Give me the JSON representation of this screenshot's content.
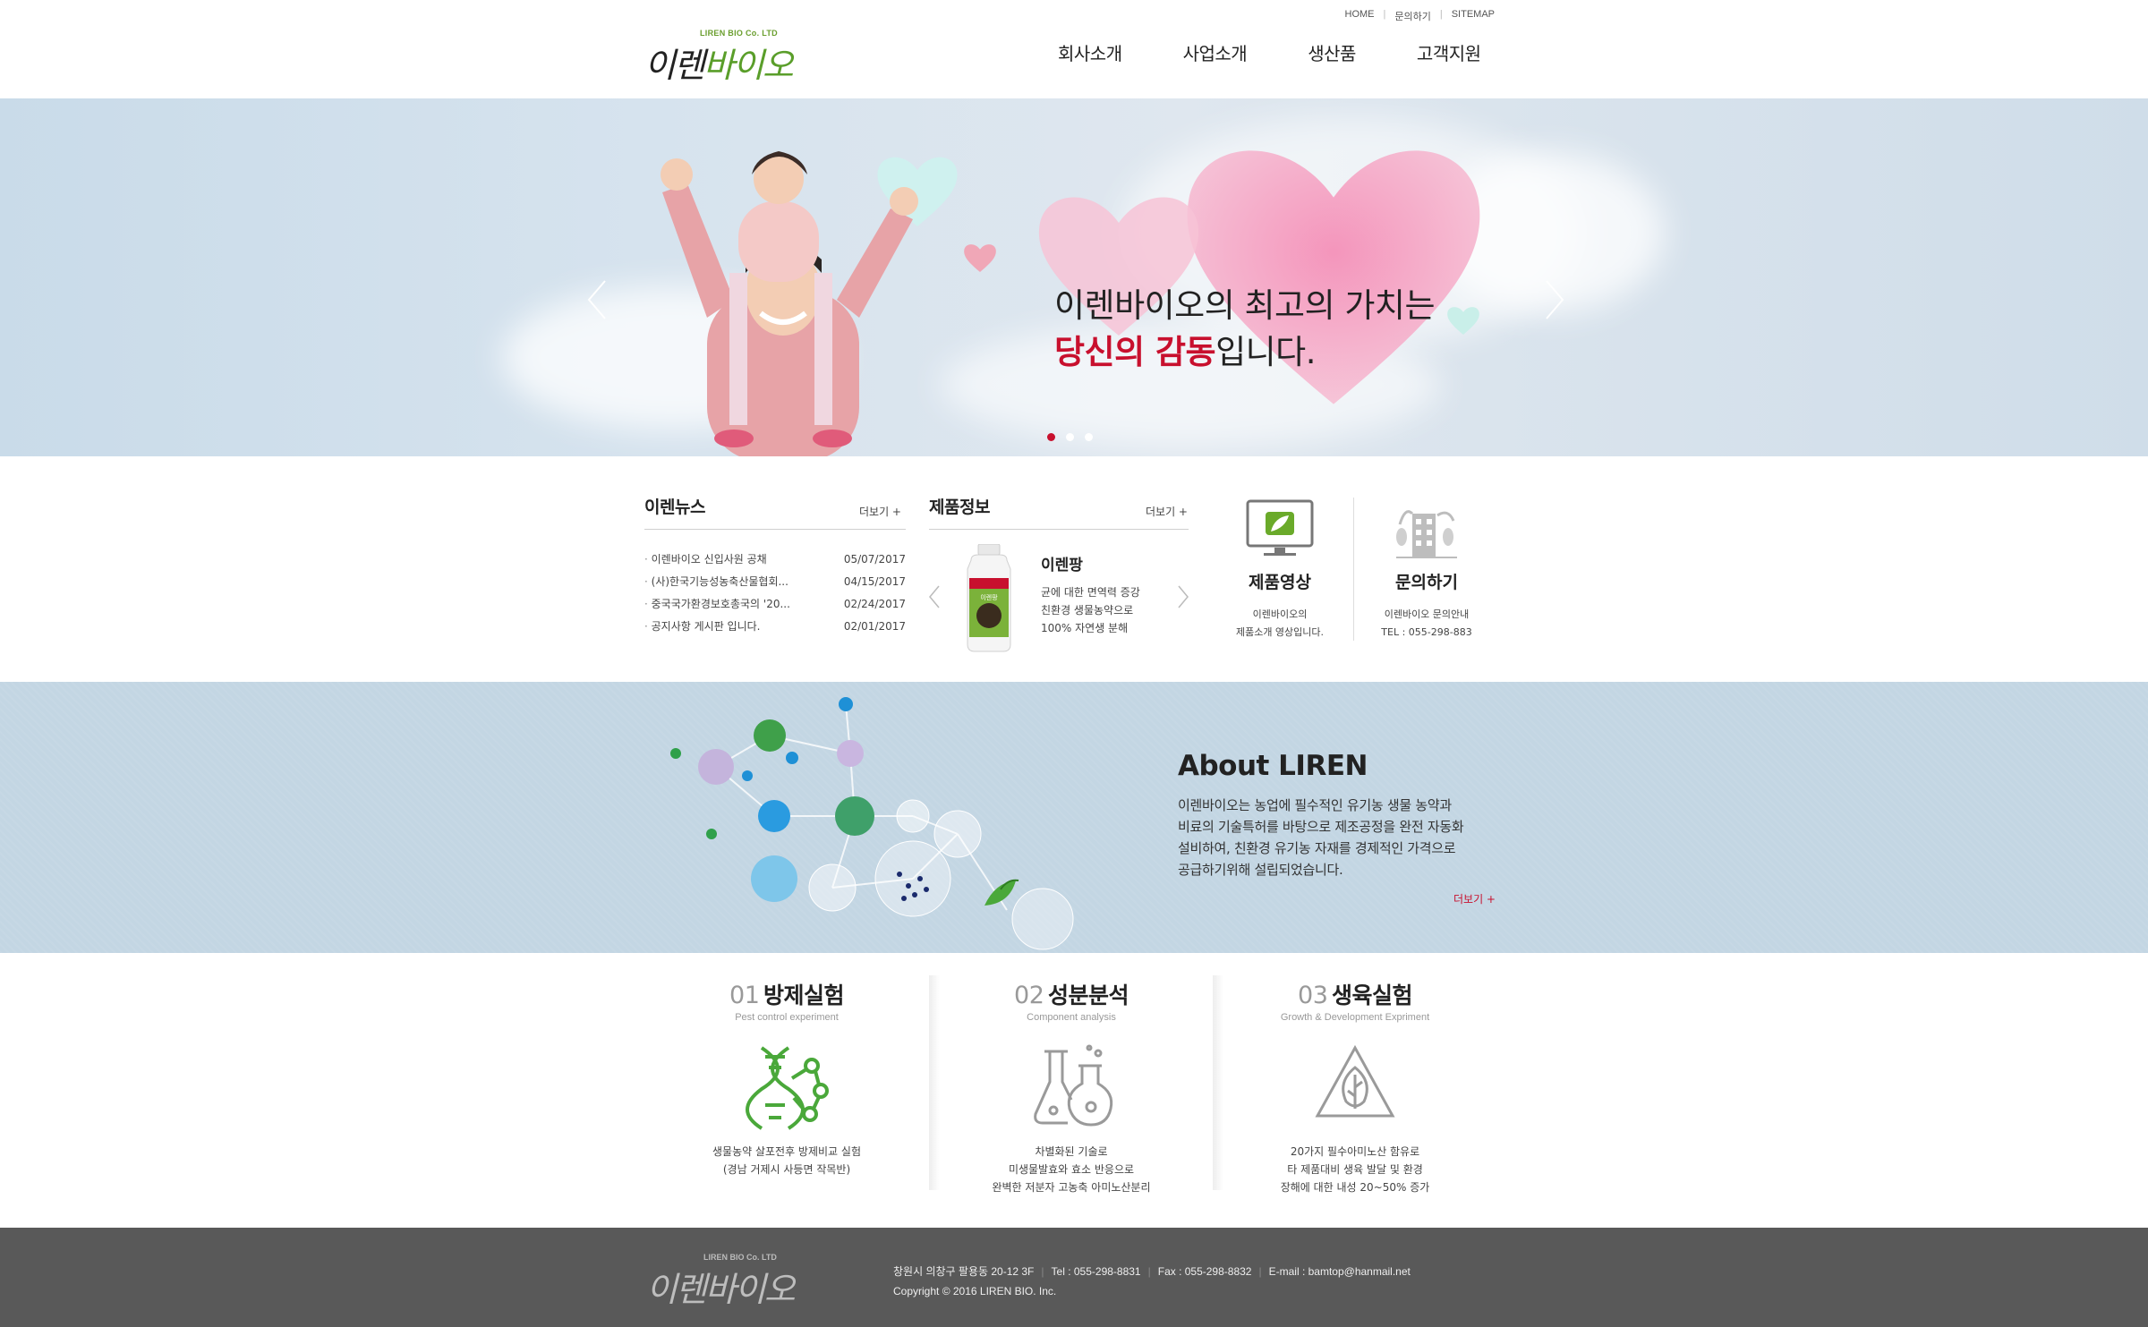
{
  "header": {
    "logo_company": "LIREN BIO Co. LTD",
    "logo_name_a": "이렌",
    "logo_name_b": "바이오",
    "util": [
      "HOME",
      "문의하기",
      "SITEMAP"
    ],
    "nav": [
      "회사소개",
      "사업소개",
      "생산품",
      "고객지원"
    ]
  },
  "hero": {
    "line1": "이렌바이오의 최고의 가치는",
    "line2_highlight": "당신의 감동",
    "line2_rest": "입니다.",
    "active_slide": 1,
    "slide_count": 3
  },
  "news": {
    "title": "이렌뉴스",
    "more": "더보기 +",
    "items": [
      {
        "title": "이렌바이오 신입사원 공채",
        "date": "05/07/2017"
      },
      {
        "title": "(사)한국기능성농축산물협회...",
        "date": "04/15/2017"
      },
      {
        "title": "중국국가환경보호총국의 '20...",
        "date": "02/24/2017"
      },
      {
        "title": "공지사항 게시판 입니다.",
        "date": "02/01/2017"
      }
    ]
  },
  "product": {
    "title": "제품정보",
    "more": "더보기 +",
    "name": "이렌팡",
    "desc": [
      "균에 대한 면역력 증강",
      "친환경 생물농약으로",
      "100% 자연생 분해"
    ],
    "label": "이렌팡"
  },
  "video": {
    "title": "제품영상",
    "desc": [
      "이렌바이오의",
      "제품소개 영상입니다."
    ]
  },
  "contact": {
    "title": "문의하기",
    "desc": [
      "이렌바이오 문의안내",
      "TEL : 055-298-883"
    ]
  },
  "about": {
    "title": "About LIREN",
    "text": [
      "이렌바이오는 농업에 필수적인 유기농 생물 농약과",
      "비료의 기술특허를 바탕으로 제조공정을 완전 자동화",
      "설비하여, 친환경 유기농 자재를 경제적인 가격으로",
      "공급하기위해 설립되었습니다."
    ],
    "more": "더보기 +"
  },
  "services": [
    {
      "num": "01",
      "title": "방제실험",
      "sub": "Pest control experiment",
      "desc": [
        "생물농약 살포전후 방제비교 실험",
        "(경남 거제시 사등면 작목반)"
      ]
    },
    {
      "num": "02",
      "title": "성분분석",
      "sub": "Component analysis",
      "desc": [
        "차별화된 기술로",
        "미생물발효와 효소 반응으로",
        "완벽한 저분자 고농축 아미노산분리"
      ]
    },
    {
      "num": "03",
      "title": "생육실험",
      "sub": "Growth & Development Expriment",
      "desc": [
        "20가지 필수아미노산 함유로",
        "타 제품대비 생육 발달 및 환경",
        "장해에 대한 내성 20~50% 증가"
      ]
    }
  ],
  "footer": {
    "logo_company": "LIREN BIO Co. LTD",
    "logo_name": "이렌바이오",
    "address": "창원시 의창구 팔용동 20-12 3F",
    "tel": "Tel : 055-298-8831",
    "fax": "Fax : 055-298-8832",
    "email": "E-mail : bamtop@hanmail.net",
    "copyright": "Copyright © 2016 LIREN BIO. Inc."
  },
  "colors": {
    "accent": "#c8102e",
    "green": "#5a9e2a",
    "footer_bg": "#595959",
    "about_bg": "#c3d6e3"
  }
}
